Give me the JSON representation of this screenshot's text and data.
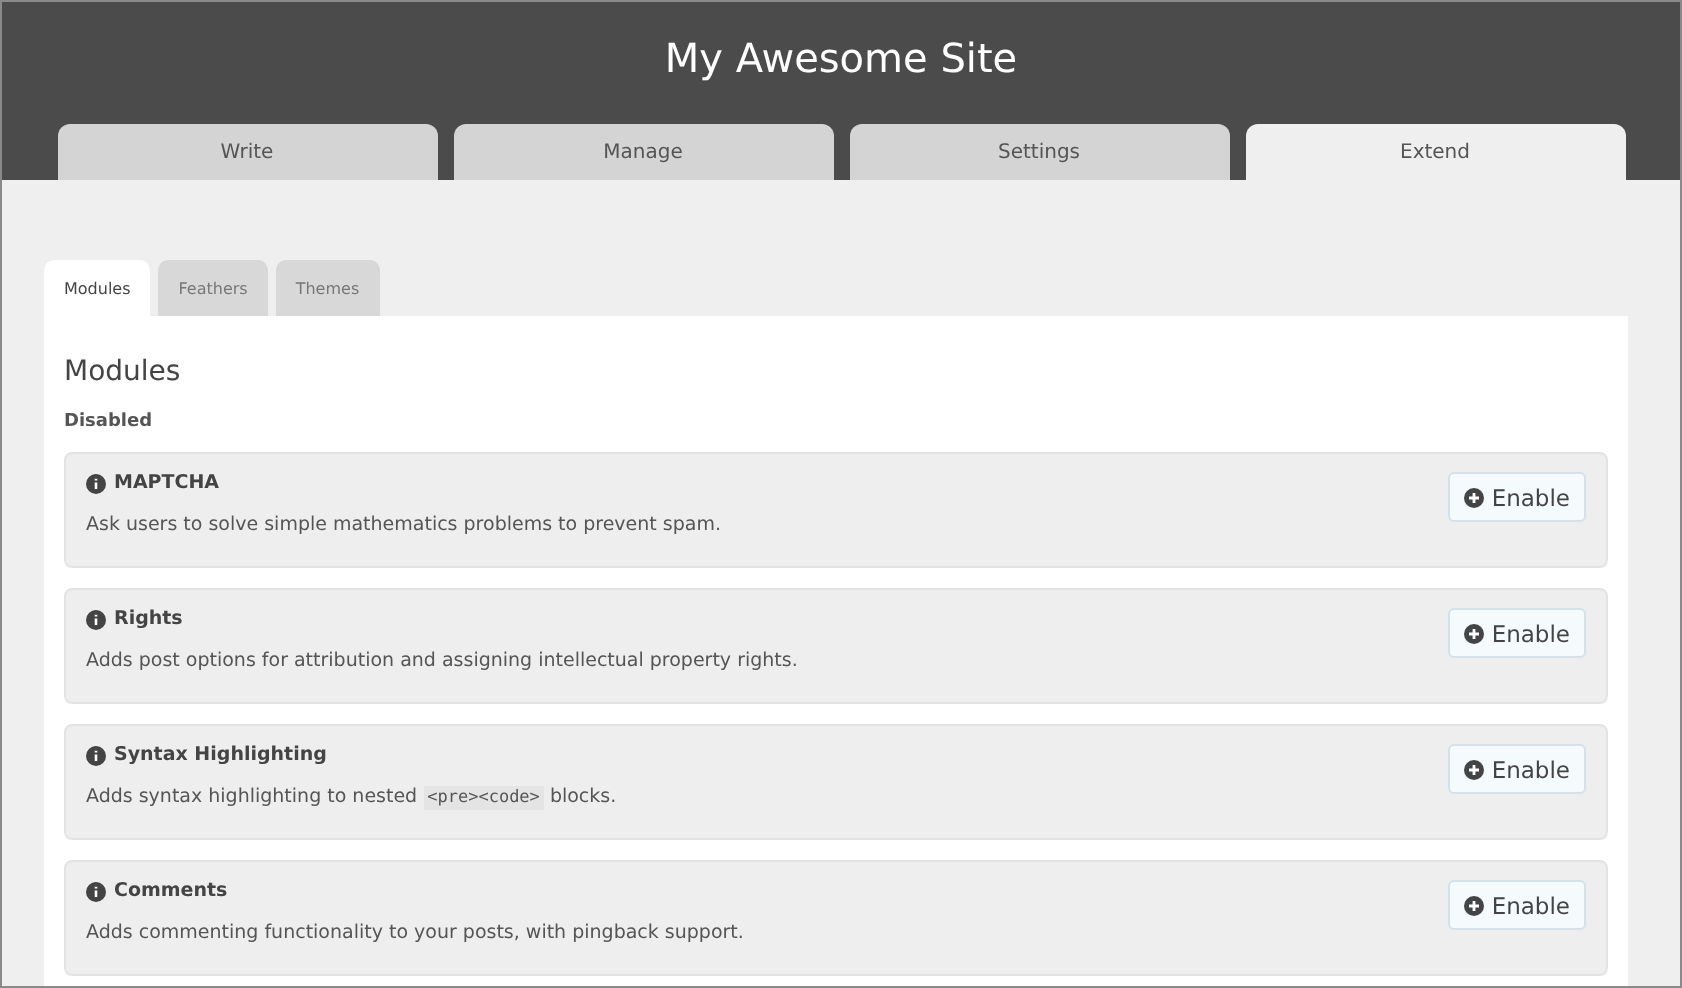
{
  "site_title": "My Awesome Site",
  "main_tabs": [
    {
      "label": "Write",
      "selected": false
    },
    {
      "label": "Manage",
      "selected": false
    },
    {
      "label": "Settings",
      "selected": false
    },
    {
      "label": "Extend",
      "selected": true
    }
  ],
  "sub_tabs": [
    {
      "label": "Modules",
      "selected": true
    },
    {
      "label": "Feathers",
      "selected": false
    },
    {
      "label": "Themes",
      "selected": false
    }
  ],
  "heading": "Modules",
  "section": "Disabled",
  "modules": [
    {
      "name": "MAPTCHA",
      "description": [
        {
          "kind": "text",
          "text": "Ask users to solve simple mathematics problems to prevent spam."
        }
      ],
      "button": "Enable"
    },
    {
      "name": "Rights",
      "description": [
        {
          "kind": "text",
          "text": "Adds post options for attribution and assigning intellectual property rights."
        }
      ],
      "button": "Enable"
    },
    {
      "name": "Syntax Highlighting",
      "description": [
        {
          "kind": "text",
          "text": "Adds syntax highlighting to nested "
        },
        {
          "kind": "code",
          "text": "<pre><code>"
        },
        {
          "kind": "text",
          "text": " blocks."
        }
      ],
      "button": "Enable"
    },
    {
      "name": "Comments",
      "description": [
        {
          "kind": "text",
          "text": "Adds commenting functionality to your posts, with pingback support."
        }
      ],
      "button": "Enable"
    }
  ]
}
